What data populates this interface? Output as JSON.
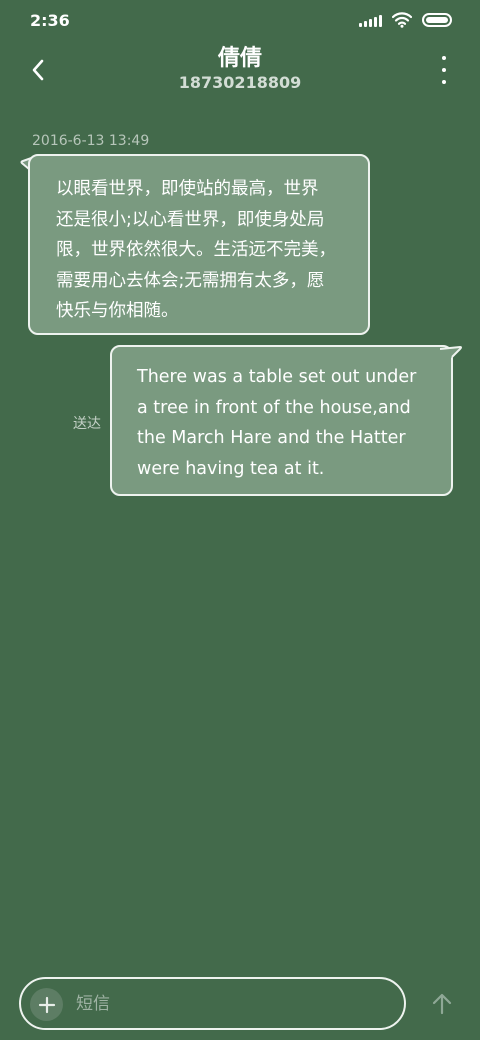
{
  "status_bar": {
    "time": "2:36",
    "icons": [
      "signal-icon",
      "wifi-icon",
      "battery-icon"
    ]
  },
  "header": {
    "back_icon": "chevron-left-icon",
    "contact_name": "倩倩",
    "contact_number": "18730218809",
    "more_icon": "vertical-dots-icon"
  },
  "conversation": {
    "timestamp": "2016-6-13 13:49",
    "messages": [
      {
        "direction": "incoming",
        "lines": [
          "以眼看世界，即使站的最高，世界",
          "还是很小;以心看世界，即使身处局",
          "限，世界依然很大。生活远不完美，",
          "需要用心去体会;无需拥有太多，愿",
          "快乐与你相随。"
        ]
      },
      {
        "direction": "outgoing",
        "status": "送达",
        "lines": [
          "There was a table set out under",
          "a tree in front of the house,and",
          "the March Hare and the Hatter",
          "were having tea at it."
        ]
      }
    ]
  },
  "composer": {
    "add_icon": "plus-icon",
    "placeholder": "短信",
    "value": "",
    "send_icon": "arrow-up-icon"
  },
  "colors": {
    "background": "#436a4b",
    "bubble": "#7a9a80",
    "bubble_border": "#eef3ef"
  }
}
